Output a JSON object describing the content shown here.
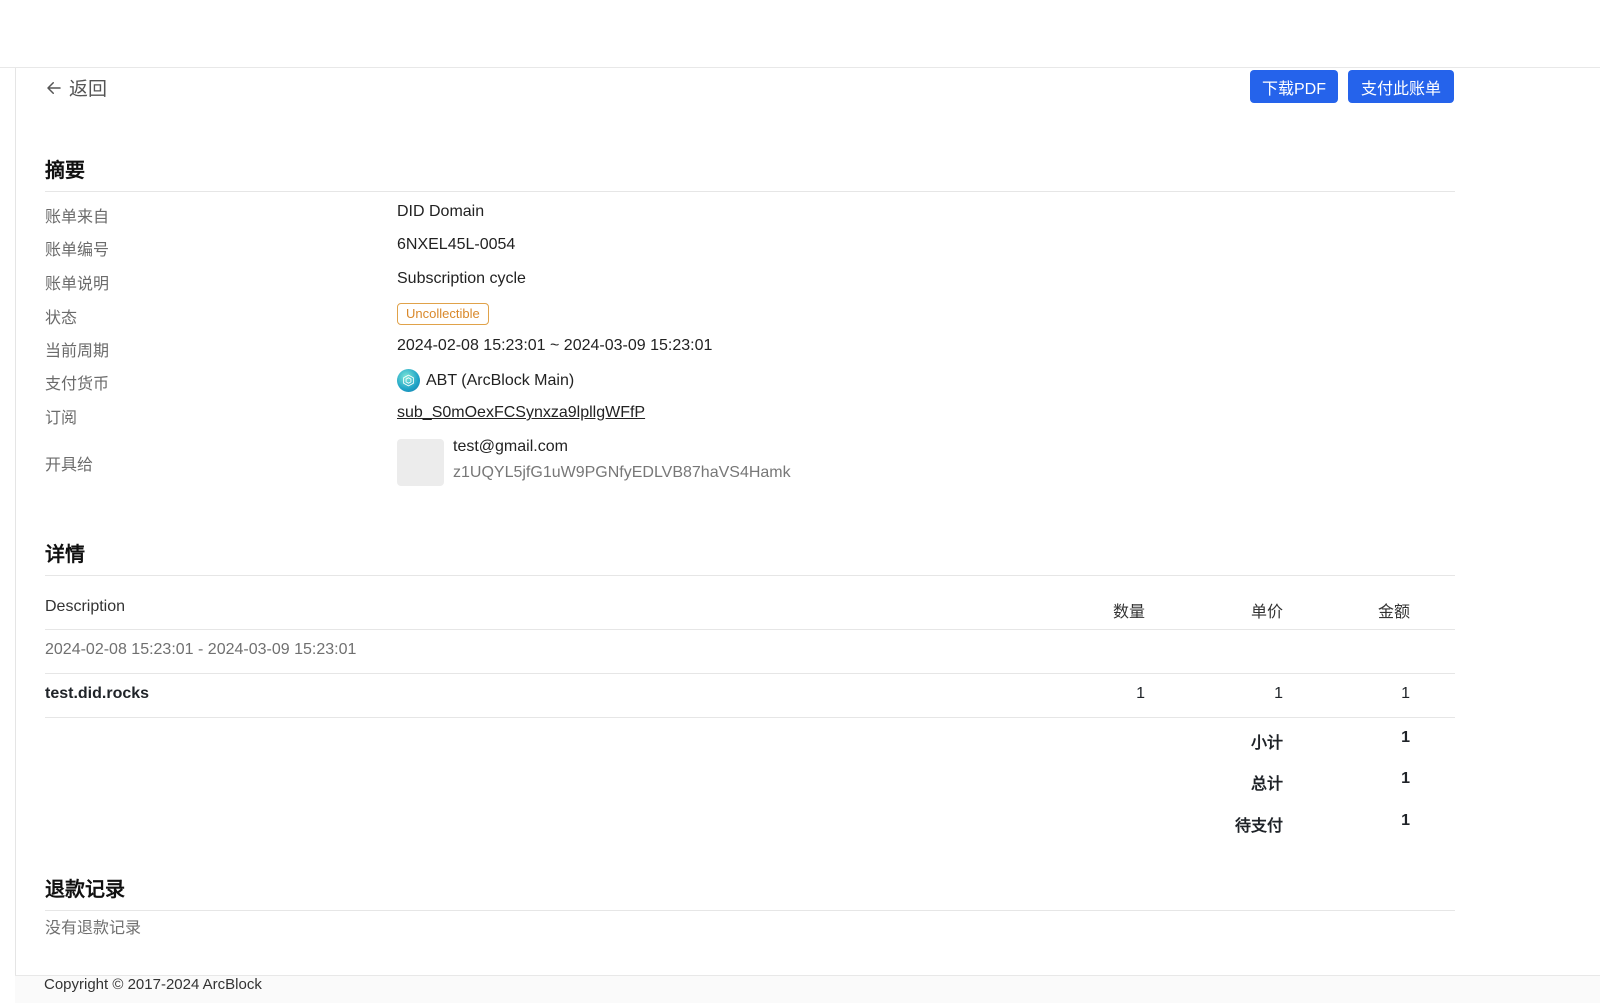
{
  "nav": {
    "back_label": "返回"
  },
  "actions": {
    "download_pdf": "下载PDF",
    "pay_invoice": "支付此账单"
  },
  "summary": {
    "title": "摘要",
    "rows": [
      {
        "label": "账单来自",
        "value": "DID Domain"
      },
      {
        "label": "账单编号",
        "value": "6NXEL45L-0054"
      },
      {
        "label": "账单说明",
        "value": "Subscription cycle"
      },
      {
        "label": "状态",
        "value": "Uncollectible"
      },
      {
        "label": "当前周期",
        "value": "2024-02-08 15:23:01 ~ 2024-03-09 15:23:01"
      },
      {
        "label": "支付货币",
        "value": "ABT (ArcBlock Main)"
      },
      {
        "label": "订阅",
        "value": "sub_S0mOexFCSynxza9lpllgWFfP"
      },
      {
        "label": "开具给",
        "email": "test@gmail.com",
        "address": "z1UQYL5jfG1uW9PGNfyEDLVB87haVS4Hamk"
      }
    ]
  },
  "details": {
    "title": "详情",
    "columns": {
      "description": "Description",
      "quantity": "数量",
      "unit_price": "单价",
      "amount": "金额"
    },
    "period": "2024-02-08 15:23:01 - 2024-03-09 15:23:01",
    "items": [
      {
        "description": "test.did.rocks",
        "quantity": "1",
        "unit_price": "1",
        "amount": "1"
      }
    ],
    "totals": [
      {
        "label": "小计",
        "value": "1"
      },
      {
        "label": "总计",
        "value": "1"
      },
      {
        "label": "待支付",
        "value": "1"
      }
    ]
  },
  "refunds": {
    "title": "退款记录",
    "empty": "没有退款记录"
  },
  "footer": {
    "copyright": "Copyright © 2017-2024 ArcBlock"
  },
  "colors": {
    "primary": "#2563eb",
    "status_uncollectible": "#d9882a",
    "link": "#1a3bb5"
  }
}
